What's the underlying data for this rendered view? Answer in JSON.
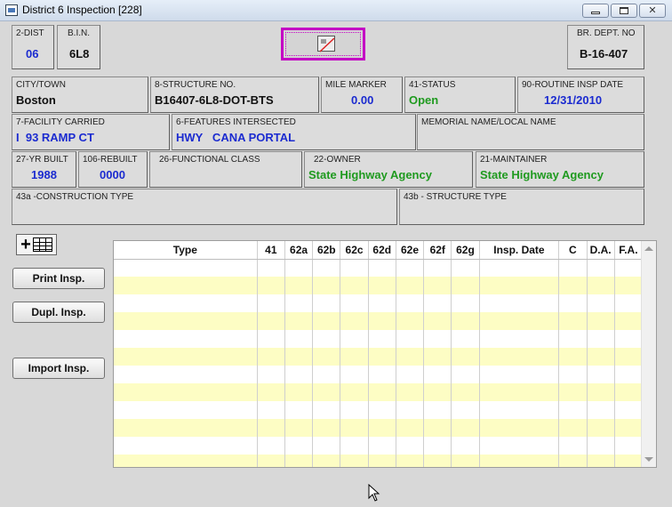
{
  "window": {
    "title": "District 6 Inspection [228]",
    "buttons": {
      "minimize": "minimize",
      "maximize": "maximize",
      "close": "close"
    }
  },
  "fields": {
    "dist": {
      "label": "2-DIST",
      "value": "06"
    },
    "bin": {
      "label": "B.I.N.",
      "value": "6L8"
    },
    "br_dept_no": {
      "label": "BR. DEPT. NO",
      "value": "B-16-407"
    },
    "city_town": {
      "label": "CITY/TOWN",
      "value": "Boston"
    },
    "structure_no": {
      "label": "8-STRUCTURE NO.",
      "value": "B16407-6L8-DOT-BTS"
    },
    "mile_marker": {
      "label": "MILE MARKER",
      "value": "0.00"
    },
    "status": {
      "label": "41-STATUS",
      "value": "Open"
    },
    "routine_insp_date": {
      "label": "90-ROUTINE INSP DATE",
      "value": "12/31/2010"
    },
    "facility_carried": {
      "label": "7-FACILITY CARRIED",
      "value": "I  93 RAMP CT"
    },
    "features_intersected": {
      "label": "6-FEATURES INTERSECTED",
      "value": "HWY   CANA PORTAL"
    },
    "memorial_name": {
      "label": "MEMORIAL NAME/LOCAL NAME",
      "value": ""
    },
    "yr_built": {
      "label": "27-YR BUILT",
      "value": "1988"
    },
    "rebuilt": {
      "label": "106-REBUILT",
      "value": "0000"
    },
    "functional_class": {
      "label": "26-FUNCTIONAL CLASS",
      "value": ""
    },
    "owner": {
      "label": "22-OWNER",
      "value": "State Highway Agency"
    },
    "maintainer": {
      "label": "21-MAINTAINER",
      "value": "State Highway Agency"
    },
    "construction_type": {
      "label": "43a -CONSTRUCTION  TYPE",
      "value": ""
    },
    "structure_type": {
      "label": "43b - STRUCTURE TYPE",
      "value": ""
    }
  },
  "actions": {
    "add_record_icon": "add-record-icon",
    "print_insp": "Print Insp.",
    "dupl_insp": "Dupl. Insp.",
    "import_insp": "Import Insp."
  },
  "grid": {
    "columns": [
      "Type",
      "41",
      "62a",
      "62b",
      "62c",
      "62d",
      "62e",
      "62f",
      "62g",
      "Insp. Date",
      "C",
      "D.A.",
      "F.A."
    ],
    "row_colors": {
      "odd": "#ffffff",
      "even": "#fdfdc4"
    }
  },
  "colors": {
    "blue_value": "#1b2bd0",
    "green_value": "#1f9a1f",
    "highlight": "#c400c4"
  }
}
